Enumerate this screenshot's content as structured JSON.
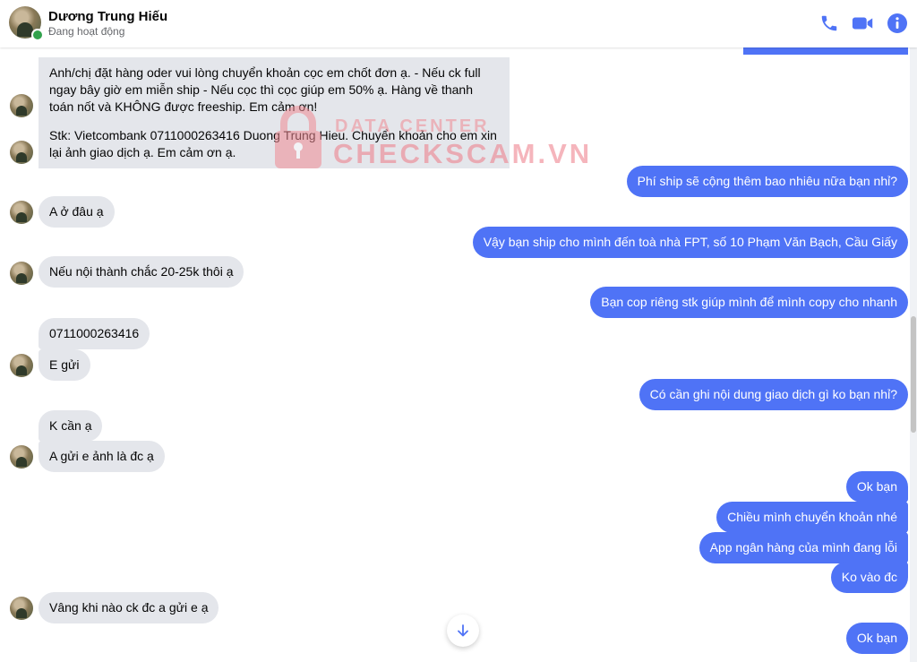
{
  "header": {
    "name": "Dương Trung Hiếu",
    "status": "Đang hoạt động",
    "icons": [
      "phone-icon",
      "video-icon",
      "info-icon"
    ]
  },
  "colors": {
    "accent": "#4f73f6",
    "incoming": "#e4e6eb",
    "online": "#31a24c"
  },
  "watermark": {
    "top": "DATA CENTER",
    "main": "CHECKSCAM.VN"
  },
  "messages": [
    {
      "from": "them",
      "text": "Anh/chị đặt hàng oder vui lòng chuyển khoản cọc em chốt đơn ạ. - Nếu ck full ngay bây giờ em miễn ship - Nếu cọc thì cọc giúp em 50% ạ. Hàng về thanh toán nốt và KHÔNG được freeship. Em cảm ơn!"
    },
    {
      "from": "them",
      "text": "Stk: Vietcombank 0711000263416 Duong Trung Hieu. Chuyển khoản cho em xin lại ảnh giao dịch ạ. Em cảm ơn ạ."
    },
    {
      "from": "me",
      "text": "Phí ship sẽ cộng thêm bao nhiêu nữa bạn nhỉ?"
    },
    {
      "from": "them",
      "text": "A ở đâu ạ"
    },
    {
      "from": "me",
      "text": "Vậy bạn ship cho mình đến toà nhà FPT, số 10 Phạm Văn Bạch, Cầu Giấy"
    },
    {
      "from": "them",
      "text": "Nếu nội thành chắc 20-25k thôi ạ"
    },
    {
      "from": "me",
      "text": "Bạn cop riêng stk giúp mình để mình copy cho nhanh"
    },
    {
      "from": "them",
      "text": "0711000263416"
    },
    {
      "from": "them",
      "text": "E gửi"
    },
    {
      "from": "me",
      "text": "Có cần ghi nội dung giao dịch gì ko bạn nhỉ?"
    },
    {
      "from": "them",
      "text": "K cần ạ"
    },
    {
      "from": "them",
      "text": "A gửi e ảnh là đc ạ"
    },
    {
      "from": "me",
      "text": "Ok bạn"
    },
    {
      "from": "me",
      "text": "Chiều mình chuyển khoản nhé"
    },
    {
      "from": "me",
      "text": "App ngân hàng của mình đang lỗi"
    },
    {
      "from": "me",
      "text": "Ko vào đc"
    },
    {
      "from": "them",
      "text": "Vâng khi nào ck đc a gửi e ạ"
    },
    {
      "from": "me",
      "text": "Ok bạn"
    }
  ]
}
